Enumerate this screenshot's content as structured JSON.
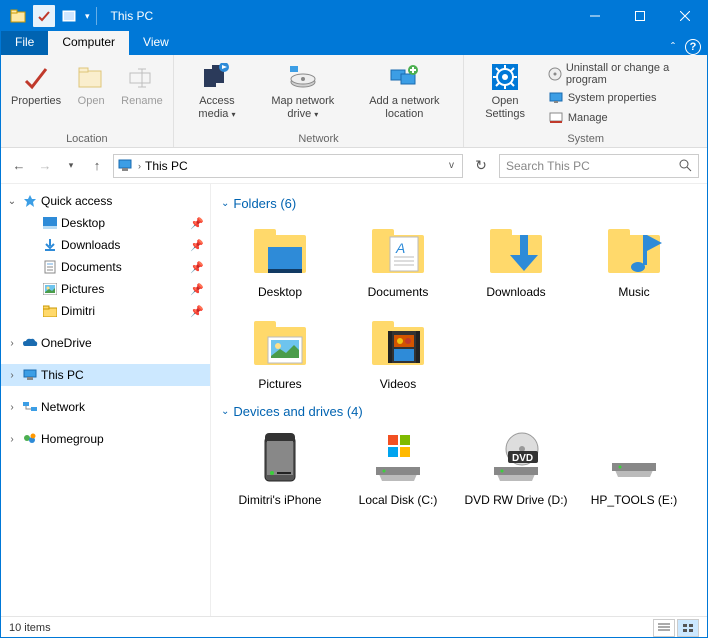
{
  "title": "This PC",
  "tabs": {
    "file": "File",
    "computer": "Computer",
    "view": "View"
  },
  "ribbon": {
    "location": {
      "label": "Location",
      "properties": "Properties",
      "open": "Open",
      "rename": "Rename"
    },
    "network": {
      "label": "Network",
      "access_media": "Access media",
      "map_drive": "Map network drive",
      "add_location": "Add a network location"
    },
    "system": {
      "label": "System",
      "open_settings": "Open Settings",
      "uninstall": "Uninstall or change a program",
      "props": "System properties",
      "manage": "Manage"
    }
  },
  "address": "This PC",
  "search_placeholder": "Search This PC",
  "nav": {
    "quick_access": "Quick access",
    "desktop": "Desktop",
    "downloads": "Downloads",
    "documents": "Documents",
    "pictures": "Pictures",
    "dimitri": "Dimitri",
    "onedrive": "OneDrive",
    "this_pc": "This PC",
    "network": "Network",
    "homegroup": "Homegroup"
  },
  "sections": {
    "folders": {
      "title": "Folders (6)",
      "items": [
        "Desktop",
        "Documents",
        "Downloads",
        "Music",
        "Pictures",
        "Videos"
      ]
    },
    "devices": {
      "title": "Devices and drives (4)",
      "items": [
        "Dimitri's iPhone",
        "Local Disk (C:)",
        "DVD RW Drive (D:)",
        "HP_TOOLS (E:)"
      ]
    }
  },
  "status": "10 items"
}
